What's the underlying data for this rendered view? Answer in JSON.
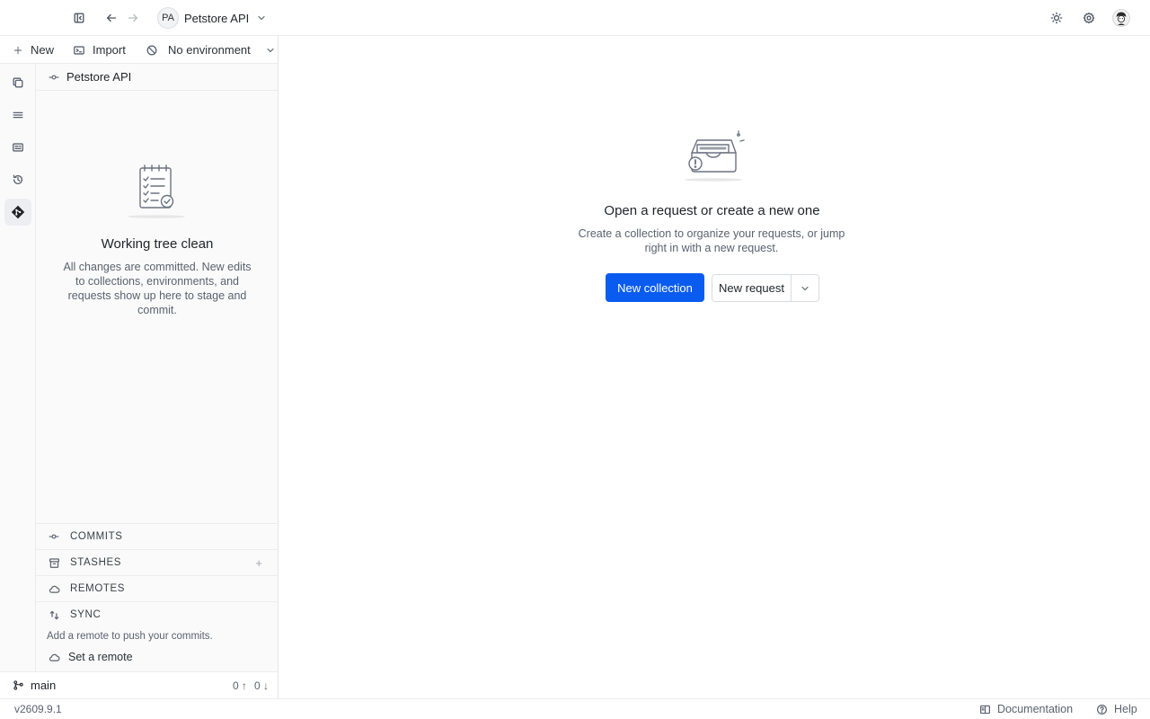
{
  "topbar": {
    "project_initials": "PA",
    "project_name": "Petstore API"
  },
  "subbar": {
    "new_label": "New",
    "import_label": "Import",
    "environment_label": "No environment"
  },
  "panel": {
    "title": "Petstore API",
    "empty_title": "Working tree clean",
    "empty_desc": "All changes are committed. New edits to collections, environments, and requests show up here to stage and commit.",
    "sections": {
      "commits": "COMMITS",
      "stashes": "STASHES",
      "remotes": "REMOTES",
      "sync": "SYNC"
    },
    "sync_hint": "Add a remote to push your commits.",
    "set_remote_label": "Set a remote"
  },
  "branch": {
    "name": "main",
    "ahead": "0 ↑",
    "behind": "0 ↓"
  },
  "main": {
    "title": "Open a request or create a new one",
    "desc": "Create a collection to organize your requests, or jump right in with a new request.",
    "new_collection_label": "New collection",
    "new_request_label": "New request"
  },
  "statusbar": {
    "version": "v2609.9.1",
    "documentation_label": "Documentation",
    "help_label": "Help"
  },
  "colors": {
    "accent": "#0a5cf0"
  }
}
